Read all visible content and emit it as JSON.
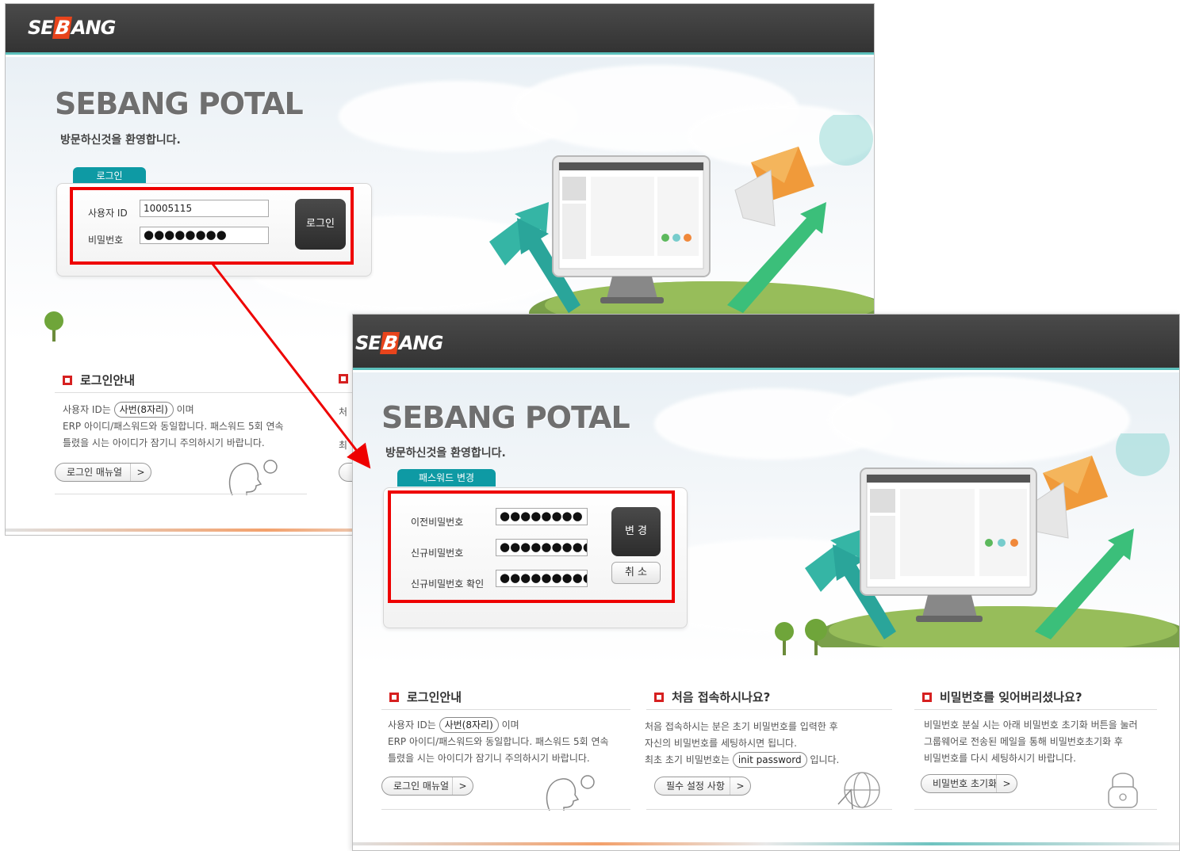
{
  "screen_login": {
    "logo": {
      "se": "SE",
      "b": "B",
      "ang": "ANG"
    },
    "portal_title": "SEBANG POTAL",
    "welcome": "방문하신것을 환영합니다.",
    "panel_tab": "로그인",
    "user_id_label": "사용자 ID",
    "user_id_value": "10005115",
    "password_label": "비밀번호",
    "password_value": "●●●●●●●●",
    "login_button": "로그인",
    "guide": {
      "title": "로그인안내",
      "line1_pre": "사용자 ID는",
      "line1_pill": "사번(8자리)",
      "line1_post": "이며",
      "line2": "ERP 아이디/패스워드와 동일합니다. 패스워드 5회 연속",
      "line3": "틀렸을 시는 아이디가 잠기니 주의하시기 바랍니다.",
      "manual_button": "로그인 매뉴얼",
      "partial_line1": "처",
      "partial_line3": "최"
    }
  },
  "screen_change": {
    "logo": {
      "se": "SE",
      "b": "B",
      "ang": "ANG"
    },
    "portal_title": "SEBANG POTAL",
    "welcome": "방문하신것을 환영합니다.",
    "panel_tab": "패스워드 변경",
    "old_pw_label": "이전비밀번호",
    "old_pw_value": "●●●●●●●●",
    "new_pw_label": "신규비밀번호",
    "new_pw_value": "●●●●●●●●●",
    "confirm_pw_label": "신규비밀번호 확인",
    "confirm_pw_value": "●●●●●●●●●",
    "change_button": "변 경",
    "cancel_button": "취 소",
    "sections": {
      "login_guide": {
        "title": "로그인안내",
        "line1_pre": "사용자 ID는",
        "line1_pill": "사번(8자리)",
        "line1_post": "이며",
        "line2": "ERP 아이디/패스워드와 동일합니다. 패스워드 5회 연속",
        "line3": "틀렸을 시는 아이디가 잠기니 주의하시기 바랍니다.",
        "button": "로그인 매뉴얼"
      },
      "first_access": {
        "title": "처음 접속하시나요?",
        "line1": "처음 접속하시는 분은 초기 비밀번호를 입력한 후",
        "line2": "자신의 비밀번호를 세팅하시면 됩니다.",
        "line3_pre": "최초 초기 비밀번호는",
        "line3_pill": "init password",
        "line3_post": "입니다.",
        "button": "필수 설정 사항"
      },
      "forgot_password": {
        "title": "비밀번호를 잊어버리셨나요?",
        "line1": "비밀번호 분실 시는 아래 비밀번호 초기화 버튼을 눌러",
        "line2": "그룹웨어로 전송된 메일을 통해 비밀번호초기화 후",
        "line3": "비밀번호를 다시 세팅하시기 바랍니다.",
        "button": "비밀번호 초기화"
      }
    }
  },
  "colors": {
    "highlight": "#ee0000",
    "teal": "#0e9aa4",
    "topbar": "#3a3a3a",
    "accent_red": "#d62020"
  },
  "icons": [
    "chevron-right-icon",
    "head-question-icon",
    "globe-cursor-icon",
    "padlock-icon",
    "tree-icon",
    "monitor-illustration",
    "envelope-icon",
    "arrow-up-icon"
  ]
}
